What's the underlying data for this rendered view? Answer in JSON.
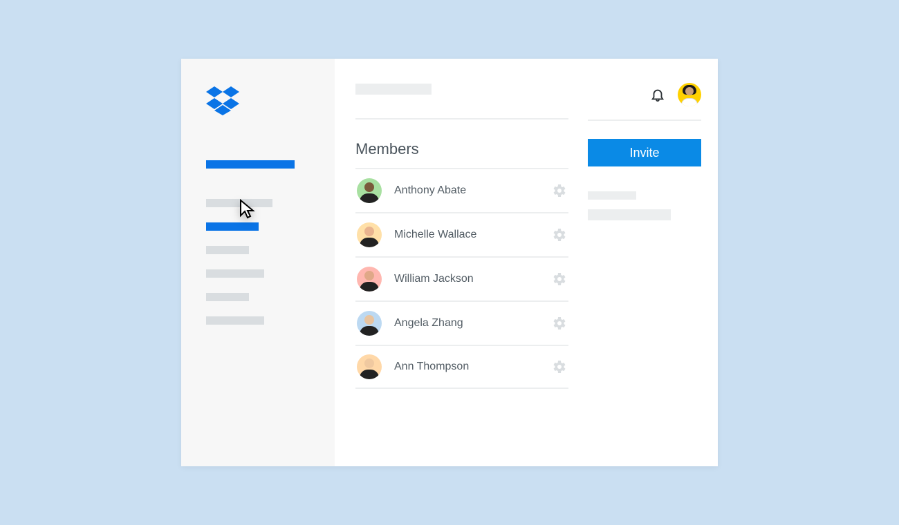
{
  "colors": {
    "accent": "#0a74e6",
    "button": "#0a8ae6"
  },
  "main": {
    "section_title": "Members",
    "members": [
      {
        "name": "Anthony Abate",
        "avatar_bg": "#a8e0a1",
        "skin": "#7a5a3a"
      },
      {
        "name": "Michelle Wallace",
        "avatar_bg": "#ffe0a8",
        "skin": "#e9b48f"
      },
      {
        "name": "William Jackson",
        "avatar_bg": "#ffb7b0",
        "skin": "#e0a888"
      },
      {
        "name": "Angela Zhang",
        "avatar_bg": "#bcd9f2",
        "skin": "#e8c4a0"
      },
      {
        "name": "Ann Thompson",
        "avatar_bg": "#ffd8a8",
        "skin": "#f0c9a0"
      }
    ]
  },
  "right": {
    "invite_label": "Invite"
  },
  "icons": {
    "logo": "dropbox-icon",
    "bell": "bell-icon",
    "gear": "gear-icon"
  }
}
